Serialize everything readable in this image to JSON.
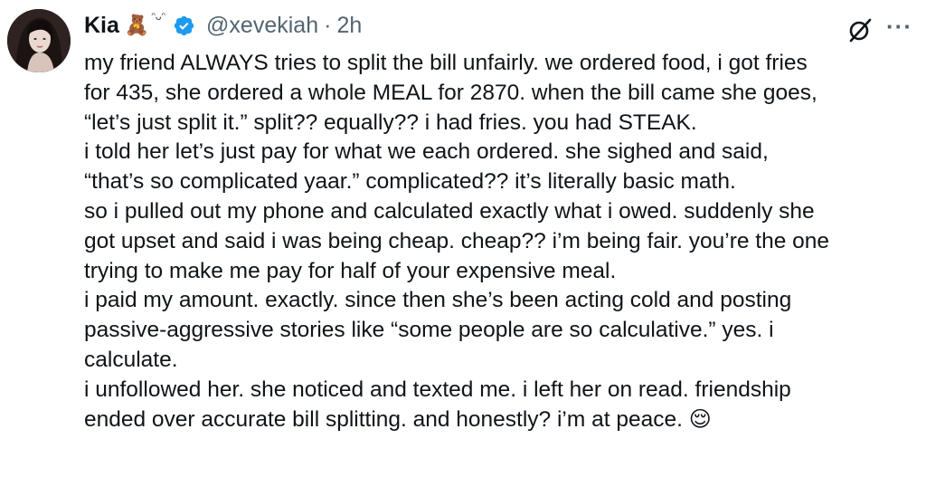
{
  "tweet": {
    "author": {
      "name": "Kia",
      "name_emoji": "🧸",
      "name_emoji_2": "ᵔᴗᵔ",
      "handle": "@xevekiah",
      "separator": "·",
      "time": "2h"
    },
    "icons": {
      "avatar": "profile-avatar",
      "verified": "verified-badge-icon",
      "grok": "grok-icon",
      "more": "more-options-icon"
    },
    "more_glyph": "···",
    "lines": [
      "my friend ALWAYS tries to split the bill unfairly. we ordered food, i got fries",
      "for 435, she ordered a whole MEAL for 2870. when the bill came she goes,",
      "“let’s just split it.” split?? equally?? i had fries. you had STEAK.",
      "i told her let’s just pay for what we each ordered. she sighed and said,",
      "“that’s so complicated yaar.” complicated?? it’s literally basic math.",
      "so i pulled out my phone and calculated exactly what i owed. suddenly she",
      "got upset and said i was being cheap. cheap?? i’m being fair. you’re the one",
      "trying to make me pay for half of your expensive meal.",
      "i paid my amount. exactly. since then she’s been acting cold and posting",
      "passive-aggressive stories like “some people are so calculative.” yes. i",
      "calculate.",
      "i unfollowed her. she noticed and texted me. i left her on read. friendship",
      "ended over accurate bill splitting. and honestly? i’m at peace."
    ],
    "final_emoji": "😌",
    "colors": {
      "text": "#0f1419",
      "secondary": "#536471",
      "verified": "#1d9bf0"
    }
  }
}
